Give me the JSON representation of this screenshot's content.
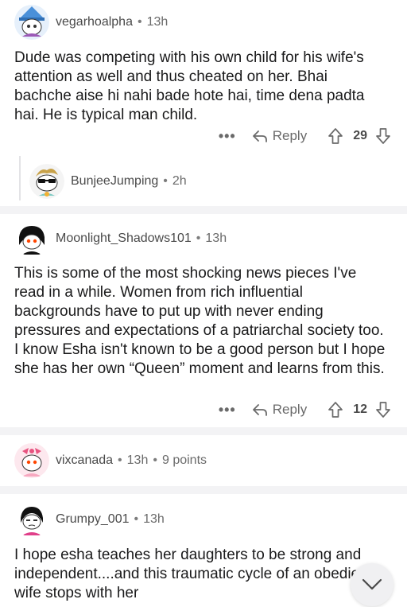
{
  "comments": [
    {
      "username": "vegarhoalpha",
      "time": "13h",
      "body": "Dude was competing with his own child for his wife's attention as well and thus cheated on her. Bhai bachche aise hi nahi bade hote hai, time dena padta hai. He is typical man child.",
      "reply_label": "Reply",
      "votes": "29",
      "more": "•••"
    },
    {
      "username": "BunjeeJumping",
      "time": "2h"
    },
    {
      "username": "Moonlight_Shadows101",
      "time": "13h",
      "body": "This is some of the most shocking news pieces I've read in a while. Women from rich influential backgrounds have to put up with never ending pressures and expectations of a patriarchal society too. I know Esha isn't known to be a good person but I hope she has her own “Queen” moment and learns from this.",
      "reply_label": "Reply",
      "votes": "12",
      "more": "•••"
    },
    {
      "username": "vixcanada",
      "time": "13h",
      "points": "9 points"
    },
    {
      "username": "Grumpy_001",
      "time": "13h",
      "body": "I hope esha teaches her daughters to be strong and independent....and this traumatic cycle of an obedient wife stops with her"
    }
  ],
  "separator": "•",
  "icons": {
    "reply": "reply-arrow-icon",
    "upvote": "upvote-arrow-icon",
    "downvote": "downvote-arrow-icon",
    "more": "more-options-icon",
    "scroll": "chevron-down-icon"
  },
  "colors": {
    "text": "#1a1a1b",
    "meta": "#6a6a6a",
    "divider": "#f3f3f5",
    "avatar_orange": "#ff4500"
  }
}
